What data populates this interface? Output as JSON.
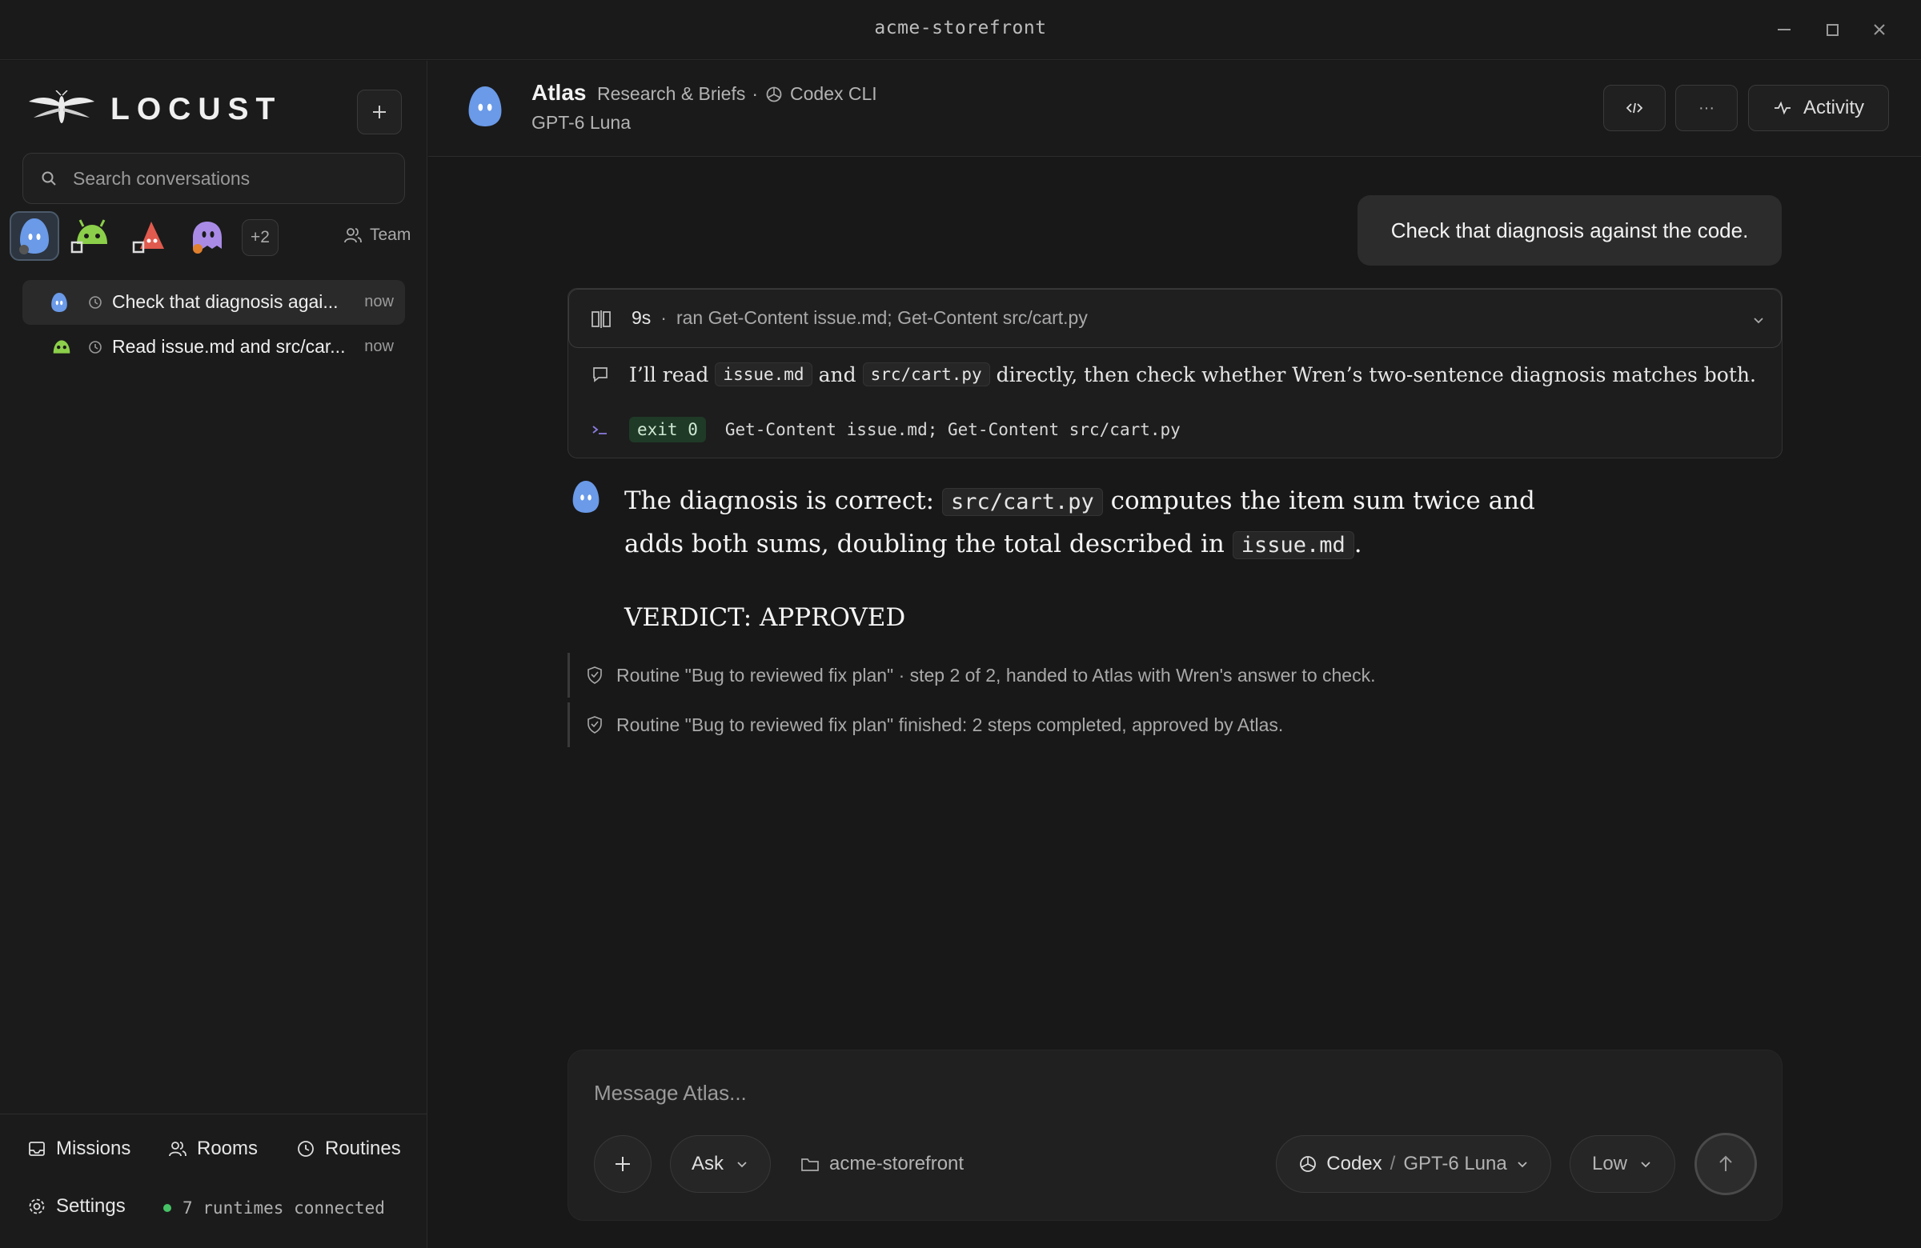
{
  "window": {
    "title": "acme-storefront"
  },
  "sidebar": {
    "brand": "LOCUST",
    "search_placeholder": "Search conversations",
    "agents_more": "+2",
    "team_label": "Team",
    "conversations": [
      {
        "title": "Check that diagnosis agai...",
        "time": "now",
        "active": true
      },
      {
        "title": "Read issue.md and src/car...",
        "time": "now",
        "active": false
      }
    ],
    "nav": {
      "missions": "Missions",
      "rooms": "Rooms",
      "routines": "Routines",
      "settings": "Settings"
    },
    "runtime_status": "7 runtimes connected",
    "status_color": "#46c266"
  },
  "header": {
    "agent_name": "Atlas",
    "agent_role": "Research & Briefs",
    "separator": "·",
    "runtime": "Codex CLI",
    "model": "GPT-6 Luna",
    "activity_label": "Activity",
    "more_label": "···"
  },
  "thread": {
    "user_message": "Check that diagnosis against the code.",
    "tool": {
      "duration": "9s",
      "dot": "·",
      "summary": "ran Get-Content issue.md; Get-Content src/cart.py",
      "note": {
        "pre": "I’ll read",
        "code1": "issue.md",
        "mid": "and",
        "code2": "src/cart.py",
        "post": "directly, then check whether Wren’s two-sentence diagnosis matches both."
      },
      "exit_badge": "exit 0",
      "command": "Get-Content issue.md; Get-Content src/cart.py"
    },
    "assistant": {
      "part1": "The diagnosis is correct:",
      "code1": "src/cart.py",
      "part2": "computes the item sum twice and adds both sums, doubling the total described in",
      "code2": "issue.md",
      "part3": ".",
      "verdict": "VERDICT: APPROVED"
    },
    "routine_events": [
      "Routine \"Bug to reviewed fix plan\" · step 2 of 2, handed to Atlas with Wren's answer to check.",
      "Routine \"Bug to reviewed fix plan\" finished: 2 steps completed, approved by Atlas."
    ]
  },
  "composer": {
    "placeholder": "Message Atlas...",
    "mode": "Ask",
    "folder": "acme-storefront",
    "provider": "Codex",
    "provider_sep": "/",
    "model": "GPT-6 Luna",
    "effort": "Low"
  }
}
